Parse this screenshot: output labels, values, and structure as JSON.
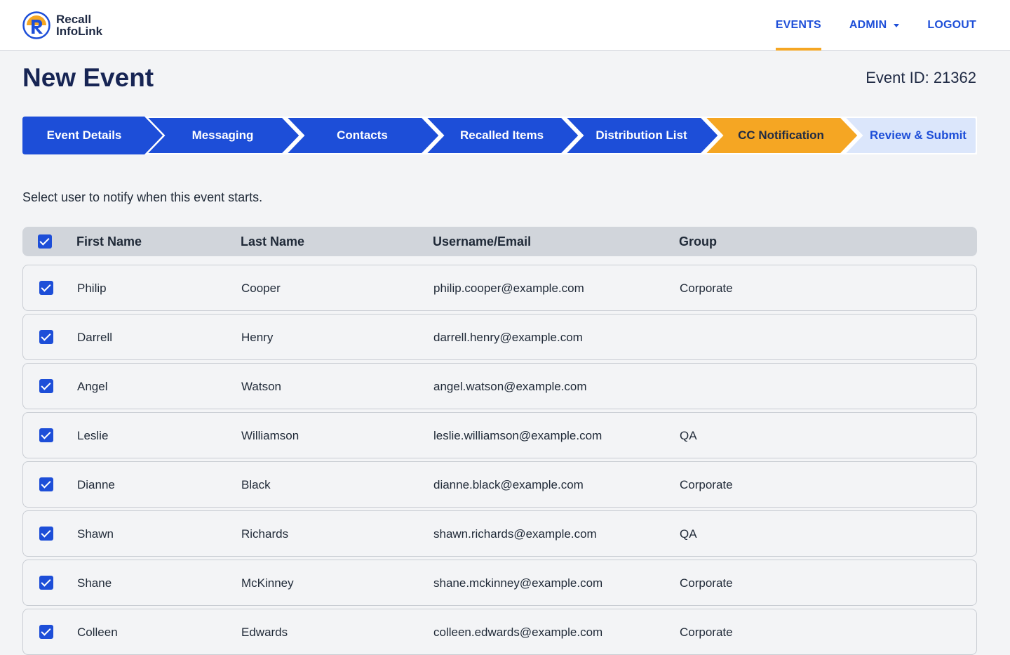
{
  "brand": {
    "line1": "Recall",
    "line2": "InfoLink",
    "colors": {
      "primary": "#1d4ed8",
      "accent": "#f5a623"
    }
  },
  "nav": {
    "events": "EVENTS",
    "admin": "ADMIN",
    "logout": "LOGOUT"
  },
  "page": {
    "title": "New Event",
    "event_id": "Event ID: 21362"
  },
  "steps": [
    {
      "label": "Event Details",
      "state": "complete"
    },
    {
      "label": "Messaging",
      "state": "complete"
    },
    {
      "label": "Contacts",
      "state": "complete"
    },
    {
      "label": "Recalled Items",
      "state": "complete"
    },
    {
      "label": "Distribution List",
      "state": "complete"
    },
    {
      "label": "CC Notification",
      "state": "current"
    },
    {
      "label": "Review & Submit",
      "state": "upcoming"
    }
  ],
  "instructions": "Select user to notify when this event starts.",
  "table": {
    "headers": [
      "First Name",
      "Last Name",
      "Username/Email",
      "Group"
    ],
    "rows": [
      {
        "first": "Philip",
        "last": "Cooper",
        "email": "philip.cooper@example.com",
        "group": "Corporate",
        "checked": true
      },
      {
        "first": "Darrell",
        "last": "Henry",
        "email": "darrell.henry@example.com",
        "group": "",
        "checked": true
      },
      {
        "first": "Angel",
        "last": "Watson",
        "email": "angel.watson@example.com",
        "group": "",
        "checked": true
      },
      {
        "first": "Leslie",
        "last": "Williamson",
        "email": "leslie.williamson@example.com",
        "group": "QA",
        "checked": true
      },
      {
        "first": "Dianne",
        "last": "Black",
        "email": "dianne.black@example.com",
        "group": "Corporate",
        "checked": true
      },
      {
        "first": "Shawn",
        "last": "Richards",
        "email": "shawn.richards@example.com",
        "group": "QA",
        "checked": true
      },
      {
        "first": "Shane",
        "last": "McKinney",
        "email": "shane.mckinney@example.com",
        "group": "Corporate",
        "checked": true
      },
      {
        "first": "Colleen",
        "last": "Edwards",
        "email": "colleen.edwards@example.com",
        "group": "Corporate",
        "checked": true
      }
    ]
  }
}
